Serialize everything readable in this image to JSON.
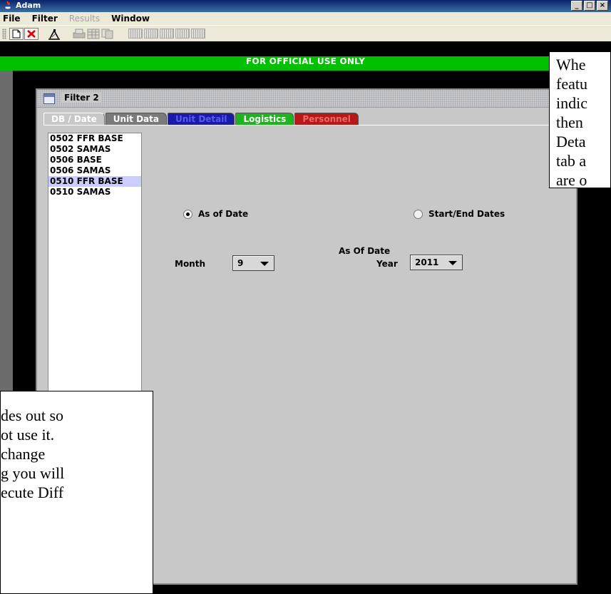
{
  "window": {
    "title": "Adam",
    "controls": [
      "_",
      "□",
      "×"
    ]
  },
  "menu": {
    "items": [
      {
        "label": "File",
        "enabled": true
      },
      {
        "label": "Filter",
        "enabled": true
      },
      {
        "label": "Results",
        "enabled": false
      },
      {
        "label": "Window",
        "enabled": true
      }
    ]
  },
  "toolbar": {
    "icons": [
      "new-document-icon",
      "close-icon",
      "filter-chart-icon",
      "print-icon",
      "grid-icon",
      "copy-icon",
      "table-icon",
      "table-icon",
      "table-icon",
      "table-icon",
      "table-icon"
    ]
  },
  "banner": {
    "text": "FOR OFFICIAL USE ONLY",
    "color": "#00c000"
  },
  "filter_frame": {
    "title": "Filter 2",
    "tabs": [
      {
        "label": "DB / Date",
        "state": "active"
      },
      {
        "label": "Unit Data",
        "state": "normal"
      },
      {
        "label": "Unit Detail",
        "state": "disabled"
      },
      {
        "label": "Logistics",
        "state": "normal"
      },
      {
        "label": "Personnel",
        "state": "disabled"
      }
    ],
    "databases": [
      {
        "label": "0502 FFR BASE",
        "selected": false
      },
      {
        "label": "0502 SAMAS",
        "selected": false
      },
      {
        "label": "0506 BASE",
        "selected": false
      },
      {
        "label": "0506 SAMAS",
        "selected": false
      },
      {
        "label": "0510 FFR BASE",
        "selected": true
      },
      {
        "label": "0510 SAMAS",
        "selected": false
      }
    ],
    "date_mode": {
      "as_of_label": "As of Date",
      "start_end_label": "Start/End Dates",
      "selected": "as_of"
    },
    "as_of": {
      "section_label": "As Of Date",
      "month_label": "Month",
      "month_value": "9",
      "year_label": "Year",
      "year_value": "2011"
    }
  },
  "callouts": {
    "top_right": "Whe\nfeatu\nindic\nthen\nDeta\ntab a\nare o",
    "bottom_left": "des out so\not use it.\nchange\ng you will\necute Diff"
  }
}
